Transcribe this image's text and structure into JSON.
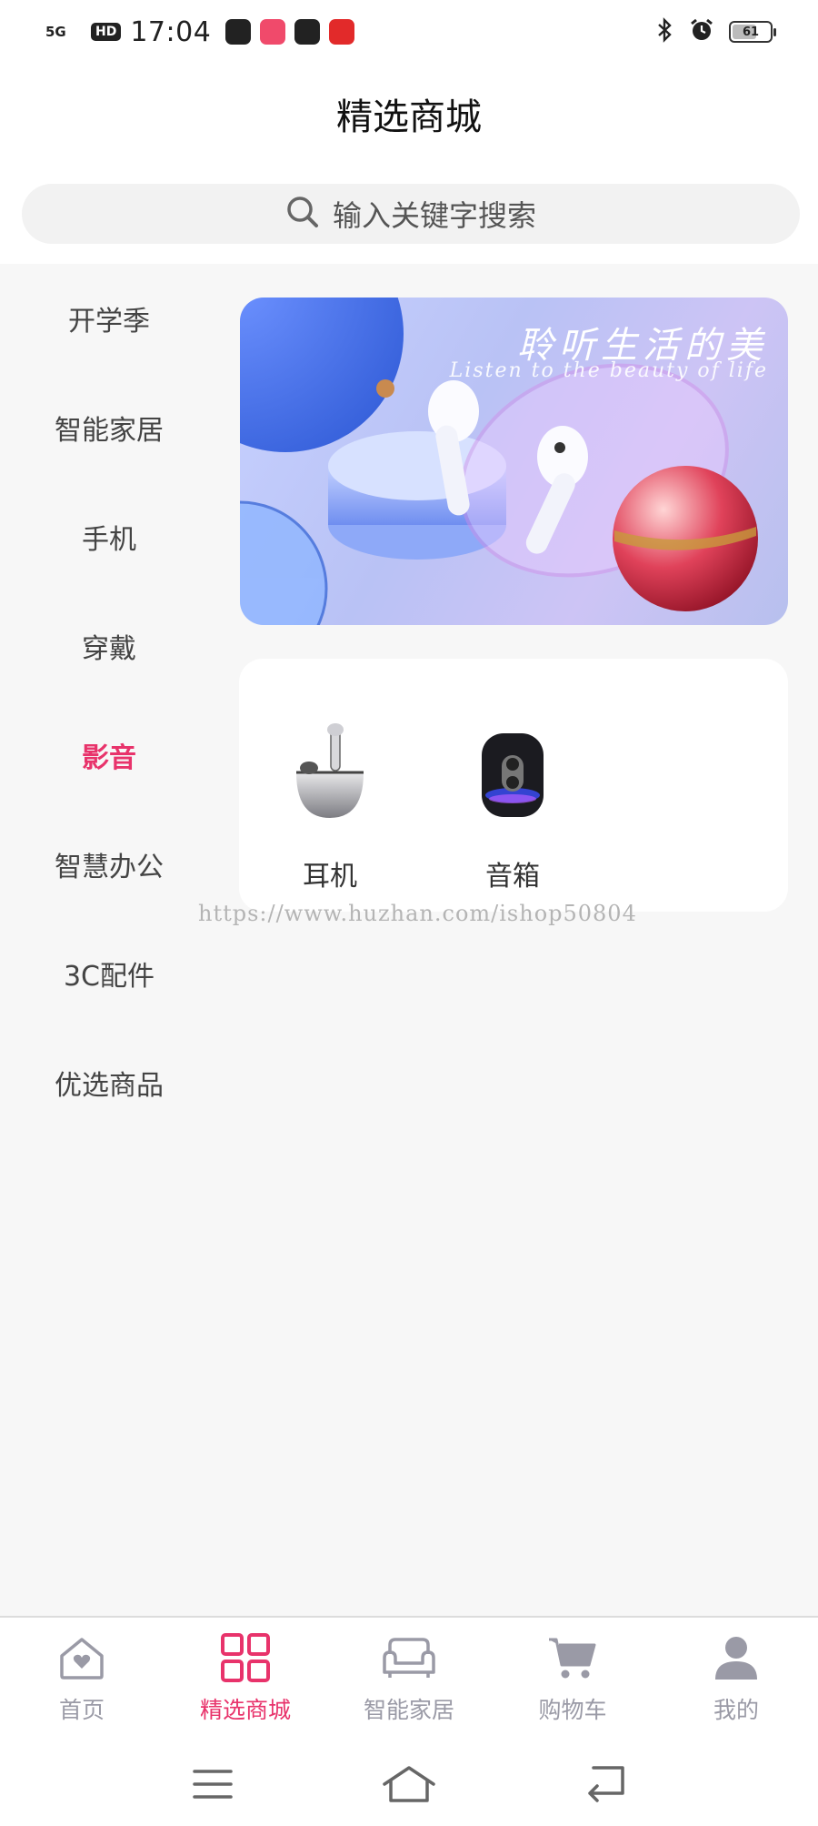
{
  "status_bar": {
    "network": "5G",
    "hd": "HD",
    "time": "17:04",
    "battery": "61"
  },
  "header": {
    "title": "精选商城"
  },
  "search": {
    "placeholder": "输入关键字搜索"
  },
  "sidebar": {
    "items": [
      {
        "label": "开学季"
      },
      {
        "label": "智能家居"
      },
      {
        "label": "手机"
      },
      {
        "label": "穿戴"
      },
      {
        "label": "影音"
      },
      {
        "label": "智慧办公"
      },
      {
        "label": "3C配件"
      },
      {
        "label": "优选商品"
      }
    ],
    "active_index": 4
  },
  "banner": {
    "title": "聆听生活的美",
    "subtitle": "Listen to the beauty of life"
  },
  "subcategories": {
    "items": [
      {
        "label": "耳机",
        "icon": "earbuds-icon"
      },
      {
        "label": "音箱",
        "icon": "speaker-icon"
      }
    ]
  },
  "watermark": "https://www.huzhan.com/ishop50804",
  "tab_bar": {
    "items": [
      {
        "label": "首页",
        "icon": "home-heart-icon"
      },
      {
        "label": "精选商城",
        "icon": "grid-icon"
      },
      {
        "label": "智能家居",
        "icon": "sofa-icon"
      },
      {
        "label": "购物车",
        "icon": "cart-icon"
      },
      {
        "label": "我的",
        "icon": "user-icon"
      }
    ],
    "active_index": 1
  },
  "colors": {
    "accent": "#e8336b",
    "inactive": "#9a9aa6",
    "background": "#f7f7f7"
  }
}
